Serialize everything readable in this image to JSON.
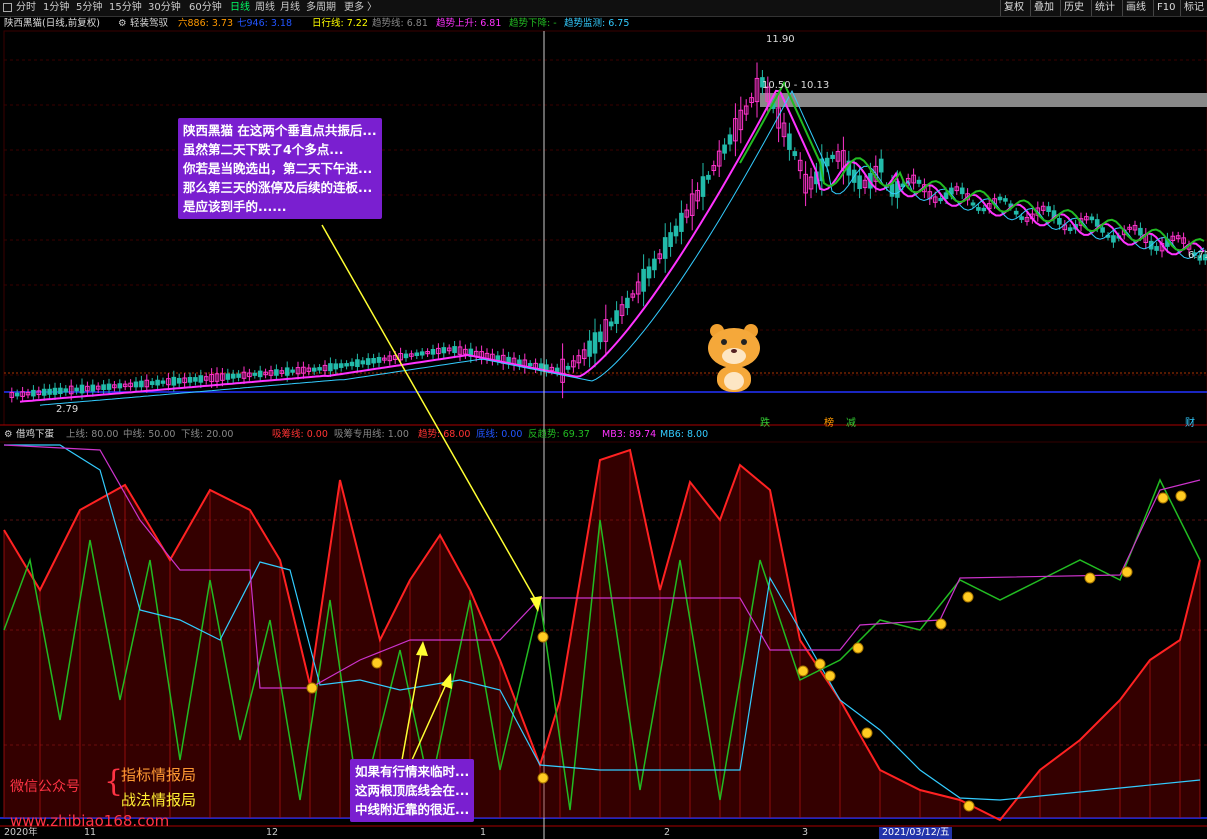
{
  "toolbar": {
    "periods": [
      "分时",
      "1分钟",
      "5分钟",
      "15分钟",
      "30分钟",
      "60分钟",
      "日线",
      "周线",
      "月线",
      "多周期",
      "更多"
    ],
    "active_period": "日线",
    "more_arrow": "〉",
    "right_buttons": [
      "复权",
      "叠加",
      "历史",
      "统计",
      "画线",
      "F10",
      "标记"
    ]
  },
  "main_panel": {
    "title": "陕西黑猫(日线,前复权)",
    "indicator_name": "轻装驾驭",
    "values": [
      {
        "label": "六886: 3.73",
        "color": "#ff9900"
      },
      {
        "label": "七946: 3.18",
        "color": "#2255ff"
      },
      {
        "label": "日行线: 7.22",
        "color": "#ffff00"
      },
      {
        "label": "趋势线: 6.81",
        "color": "#888888"
      },
      {
        "label": "趋势上升: 6.81",
        "color": "#ff33ff"
      },
      {
        "label": "趋势下降: -",
        "color": "#22bb22"
      },
      {
        "label": "趋势监测: 6.75",
        "color": "#33ccff"
      }
    ],
    "price_high": "11.90",
    "price_range": "10.50 - 10.13",
    "price_low": "2.79",
    "price_last": "6.71",
    "event_tags": [
      {
        "text": "跌",
        "color": "#33cc33"
      },
      {
        "text": "榜",
        "color": "#ff9900"
      },
      {
        "text": "减",
        "color": "#33cc33"
      },
      {
        "text": "财",
        "color": "#33ccff"
      }
    ]
  },
  "sub_panel": {
    "title": "借鸡下蛋",
    "values": [
      {
        "label": "上线: 80.00",
        "color": "#888888"
      },
      {
        "label": "中线: 50.00",
        "color": "#888888"
      },
      {
        "label": "下线: 20.00",
        "color": "#888888"
      },
      {
        "label": "吸筹线: 0.00",
        "color": "#ff3333"
      },
      {
        "label": "吸筹专用线: 1.00",
        "color": "#888888"
      },
      {
        "label": "趋势: 68.00",
        "color": "#ff3333"
      },
      {
        "label": "底线: 0.00",
        "color": "#2255ff"
      },
      {
        "label": "反趋势: 69.37",
        "color": "#22bb22"
      },
      {
        "label": "MB3: 89.74",
        "color": "#ff33ff"
      },
      {
        "label": "MB6: 8.00",
        "color": "#33ccff"
      }
    ]
  },
  "annotations": {
    "top_bubble": [
      "陕西黑猫 在这两个垂直点共振后...",
      "虽然第二天下跌了4个多点...",
      "你若是当晚选出，第二天下午进...",
      "那么第三天的涨停及后续的连板...",
      "是应该到手的......"
    ],
    "bottom_bubble": [
      "如果有行情来临时...",
      "这两根顶底线会在...",
      "中线附近靠的很近..."
    ]
  },
  "watermark": {
    "wechat": "微信公众号",
    "brace": "{",
    "line1": "指标情报局",
    "line2": "战法情报局",
    "url": "www.zhibiao168.com"
  },
  "date_axis": {
    "labels": [
      "2020年",
      "11",
      "12",
      "1",
      "2",
      "3"
    ],
    "cursor_date": "2021/03/12/五"
  },
  "colors": {
    "up": "#ff33cc",
    "down": "#22bbaa",
    "trend_up": "#ff33ff",
    "trend_down": "#22bb22",
    "monitor": "#33ccff",
    "curve_red": "#ff2222",
    "curve_green": "#22bb22",
    "curve_cyan": "#33ccff",
    "curve_magenta": "#cc33cc"
  }
}
